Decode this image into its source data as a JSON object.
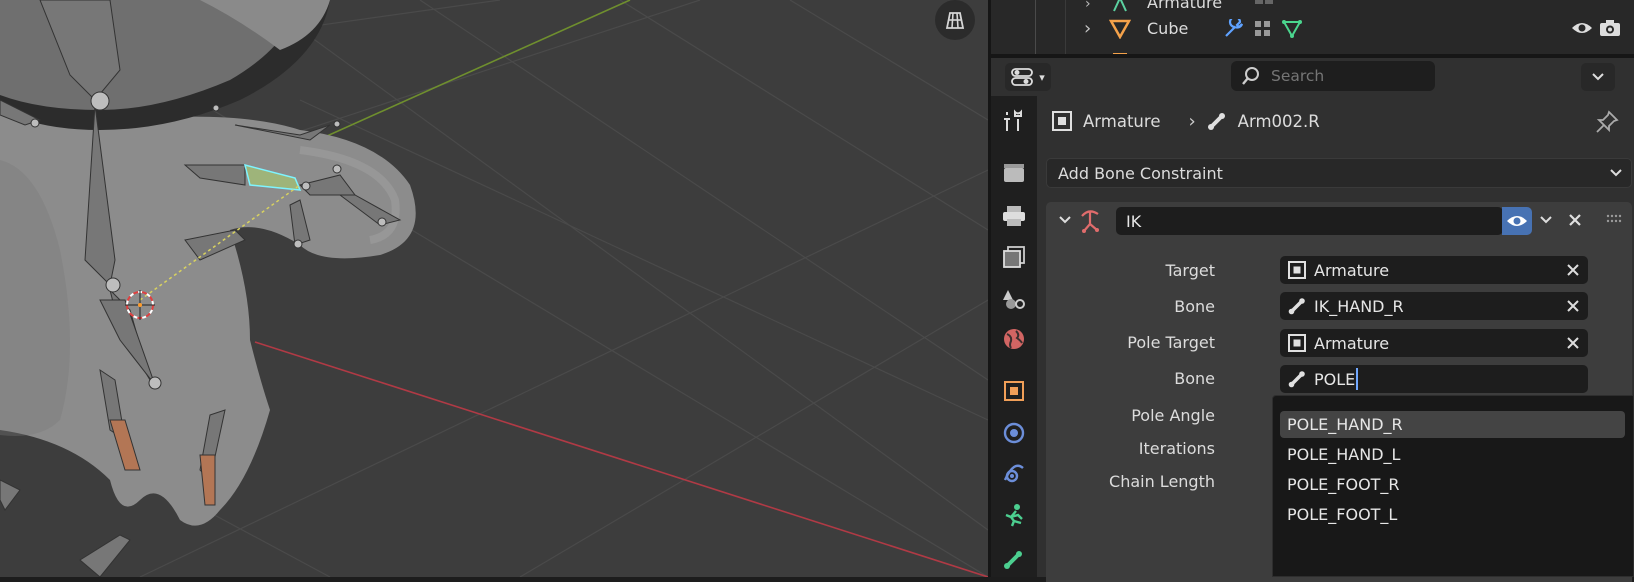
{
  "outliner": {
    "rows": [
      {
        "label": "Armature",
        "icon": "armature-icon"
      },
      {
        "label": "Cube",
        "icon": "mesh-object-icon"
      }
    ]
  },
  "header": {
    "search_placeholder": "Search"
  },
  "tabs": [
    "tool-icon",
    "render-icon",
    "output-icon",
    "view-layer-icon",
    "scene-icon",
    "world-icon",
    "object-icon",
    "modifier-physics-icon",
    "particles-icon",
    "object-constraint-icon",
    "object-data-armature-icon",
    "bone-icon"
  ],
  "breadcrumb": {
    "object": "Armature",
    "bone": "Arm002.R"
  },
  "add_constraint_label": "Add Bone Constraint",
  "constraint": {
    "name": "IK",
    "target_label": "Target",
    "target_value": "Armature",
    "bone_label": "Bone",
    "bone_value": "IK_HAND_R",
    "pole_target_label": "Pole Target",
    "pole_target_value": "Armature",
    "pole_bone_label": "Bone",
    "pole_bone_value": "POLE",
    "pole_angle_label": "Pole Angle",
    "iterations_label": "Iterations",
    "chain_length_label": "Chain Length"
  },
  "dropdown": {
    "items": [
      "POLE_HAND_R",
      "POLE_HAND_L",
      "POLE_FOOT_R",
      "POLE_FOOT_L"
    ],
    "active_index": 0
  },
  "colors": {
    "accent": "#4772b3",
    "text_caret": "#71a8ff",
    "viewport_bg": "#3d3d3d",
    "x_axis": "#b94a52",
    "y_axis": "#7ea03a",
    "ik_icon": "#e06c6c"
  }
}
